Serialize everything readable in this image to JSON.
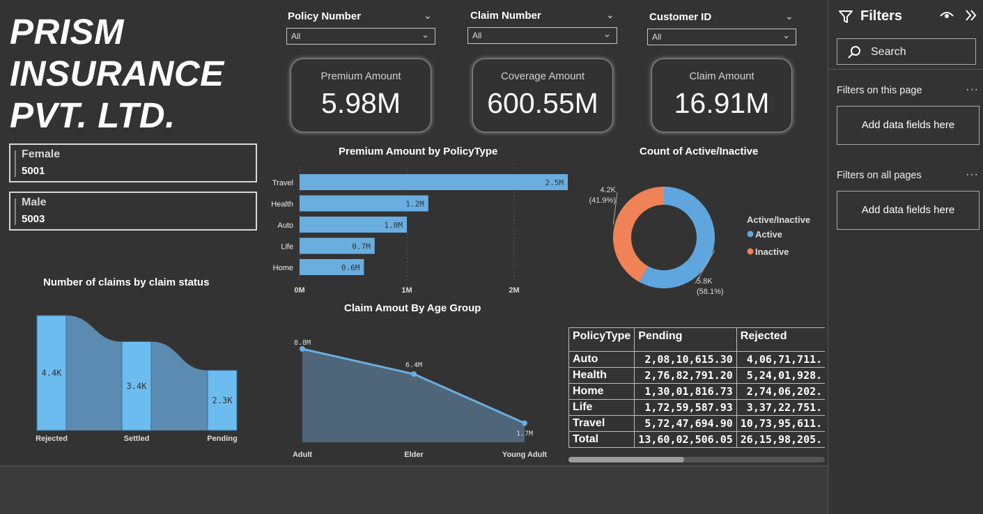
{
  "company": {
    "line1": "PRISM",
    "line2": "INSURANCE",
    "line3": "PVT. LTD."
  },
  "gender_cards": [
    {
      "label": "Female",
      "value": "5001"
    },
    {
      "label": "Male",
      "value": "5003"
    }
  ],
  "slicers": [
    {
      "title": "Policy Number",
      "value": "All"
    },
    {
      "title": "Claim Number",
      "value": "All"
    },
    {
      "title": "Customer ID",
      "value": "All"
    }
  ],
  "kpis": [
    {
      "title": "Premium Amount",
      "value": "5.98M"
    },
    {
      "title": "Coverage Amount",
      "value": "600.55M"
    },
    {
      "title": "Claim Amount",
      "value": "16.91M"
    }
  ],
  "colors": {
    "bar": "#6aaee0",
    "active": "#5fa6df",
    "inactive": "#f08257",
    "waterfall_bar": "#6cbcf0",
    "ribbon": "#5b8bb0",
    "area": "#4f6579",
    "line": "#6aaee0"
  },
  "chart_data": [
    {
      "type": "bar",
      "title": "Premium Amount by PolicyType",
      "categories": [
        "Travel",
        "Health",
        "Auto",
        "Life",
        "Home"
      ],
      "values": [
        2.5,
        1.2,
        1.0,
        0.7,
        0.6
      ],
      "data_labels": [
        "2.5M",
        "1.2M",
        "1.0M",
        "0.7M",
        "0.6M"
      ],
      "x_ticks": [
        "0M",
        "1M",
        "2M"
      ],
      "xlim": [
        0,
        2.5
      ],
      "orientation": "horizontal"
    },
    {
      "type": "pie",
      "title": "Count of Active/Inactive",
      "legend_title": "Active/Inactive",
      "labels": [
        "Active",
        "Inactive"
      ],
      "values": [
        5.8,
        4.2
      ],
      "percents": [
        58.1,
        41.9
      ],
      "data_labels": [
        [
          "5.8K",
          "(58.1%)"
        ],
        [
          "4.2K",
          "(41.9%)"
        ]
      ],
      "donut": true,
      "legend": "right"
    },
    {
      "type": "bar",
      "title": "Number of claims by claim status",
      "categories": [
        "Rejected",
        "Settled",
        "Pending"
      ],
      "values": [
        4.4,
        3.4,
        2.3
      ],
      "data_labels": [
        "4.4K",
        "3.4K",
        "2.3K"
      ],
      "ribbons": true
    },
    {
      "type": "area",
      "title": "Claim Amout By Age Group",
      "categories": [
        "Adult",
        "Elder",
        "Young Adult"
      ],
      "values": [
        8.8,
        6.4,
        1.7
      ],
      "data_labels": [
        "8.8M",
        "6.4M",
        "1.7M"
      ]
    }
  ],
  "matrix": {
    "headers": [
      "PolicyType",
      "Pending",
      "Rejected"
    ],
    "rows": [
      [
        "Auto",
        "2,08,10,615.30",
        "4,06,71,711."
      ],
      [
        "Health",
        "2,76,82,791.20",
        "5,24,01,928."
      ],
      [
        "Home",
        "1,30,01,816.73",
        "2,74,06,202."
      ],
      [
        "Life",
        "1,72,59,587.93",
        "3,37,22,751."
      ],
      [
        "Travel",
        "5,72,47,694.90",
        "10,73,95,611."
      ],
      [
        "Total",
        "13,60,02,506.05",
        "26,15,98,205."
      ]
    ]
  },
  "filters_pane": {
    "title": "Filters",
    "search_placeholder": "Search",
    "section_page": "Filters on this page",
    "section_all": "Filters on all pages",
    "add_fields": "Add data fields here",
    "icons": [
      "filter-icon",
      "eye-icon",
      "collapse-icon",
      "search-icon",
      "more-options-icon"
    ]
  }
}
